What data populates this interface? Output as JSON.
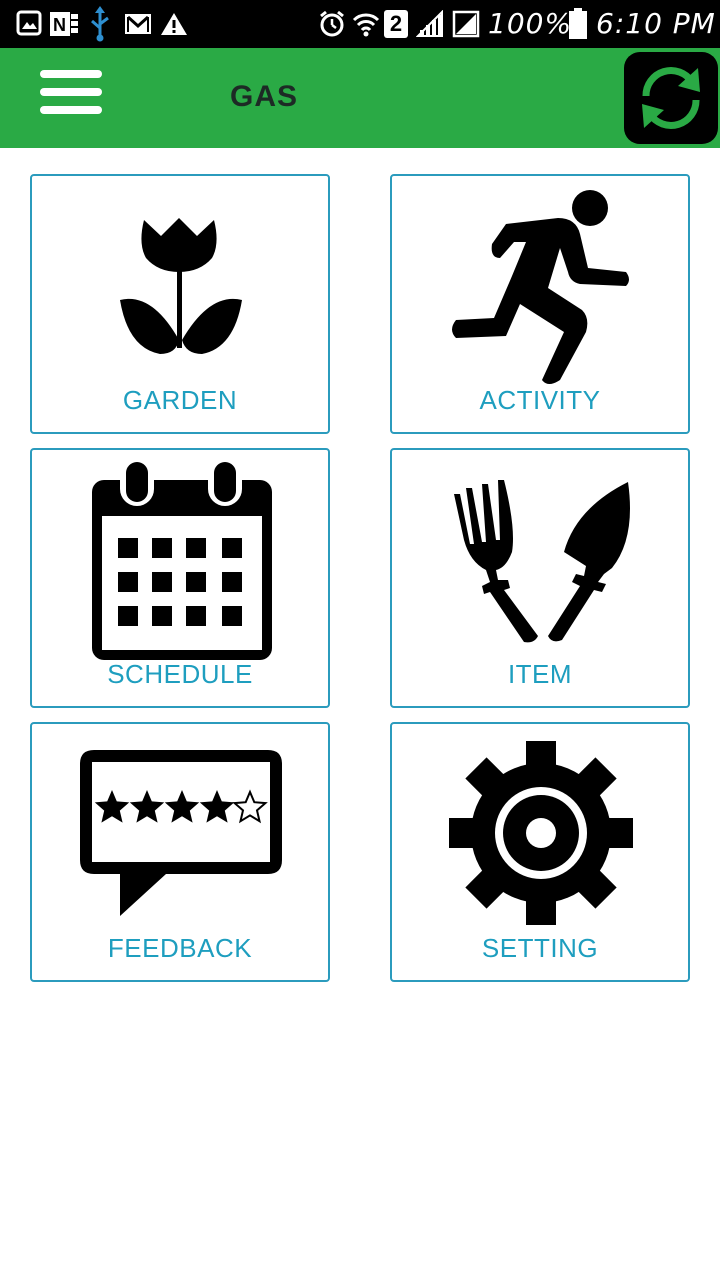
{
  "status_bar": {
    "battery_percent": "100%",
    "time": "6:10 PM",
    "sim_slot": "2",
    "icons": [
      "gallery-icon",
      "onenote-icon",
      "usb-icon",
      "gmail-icon",
      "warning-icon",
      "alarm-icon",
      "wifi-icon",
      "sim-icon",
      "signal-icon",
      "no-signal-icon",
      "battery-icon"
    ]
  },
  "app_bar": {
    "title": "GAS",
    "menu_icon": "hamburger-menu-icon",
    "refresh_icon": "refresh-icon",
    "color": "#2aaa45"
  },
  "tiles": [
    {
      "label": "GARDEN",
      "icon": "tulip-icon"
    },
    {
      "label": "ACTIVITY",
      "icon": "running-person-icon"
    },
    {
      "label": "SCHEDULE",
      "icon": "calendar-icon"
    },
    {
      "label": "ITEM",
      "icon": "garden-tools-icon"
    },
    {
      "label": "FEEDBACK",
      "icon": "rating-feedback-icon"
    },
    {
      "label": "SETTING",
      "icon": "gear-icon"
    }
  ],
  "colors": {
    "accent": "#2aaa45",
    "tile_border": "#2b9bbd",
    "tile_label": "#1e9ebf"
  }
}
